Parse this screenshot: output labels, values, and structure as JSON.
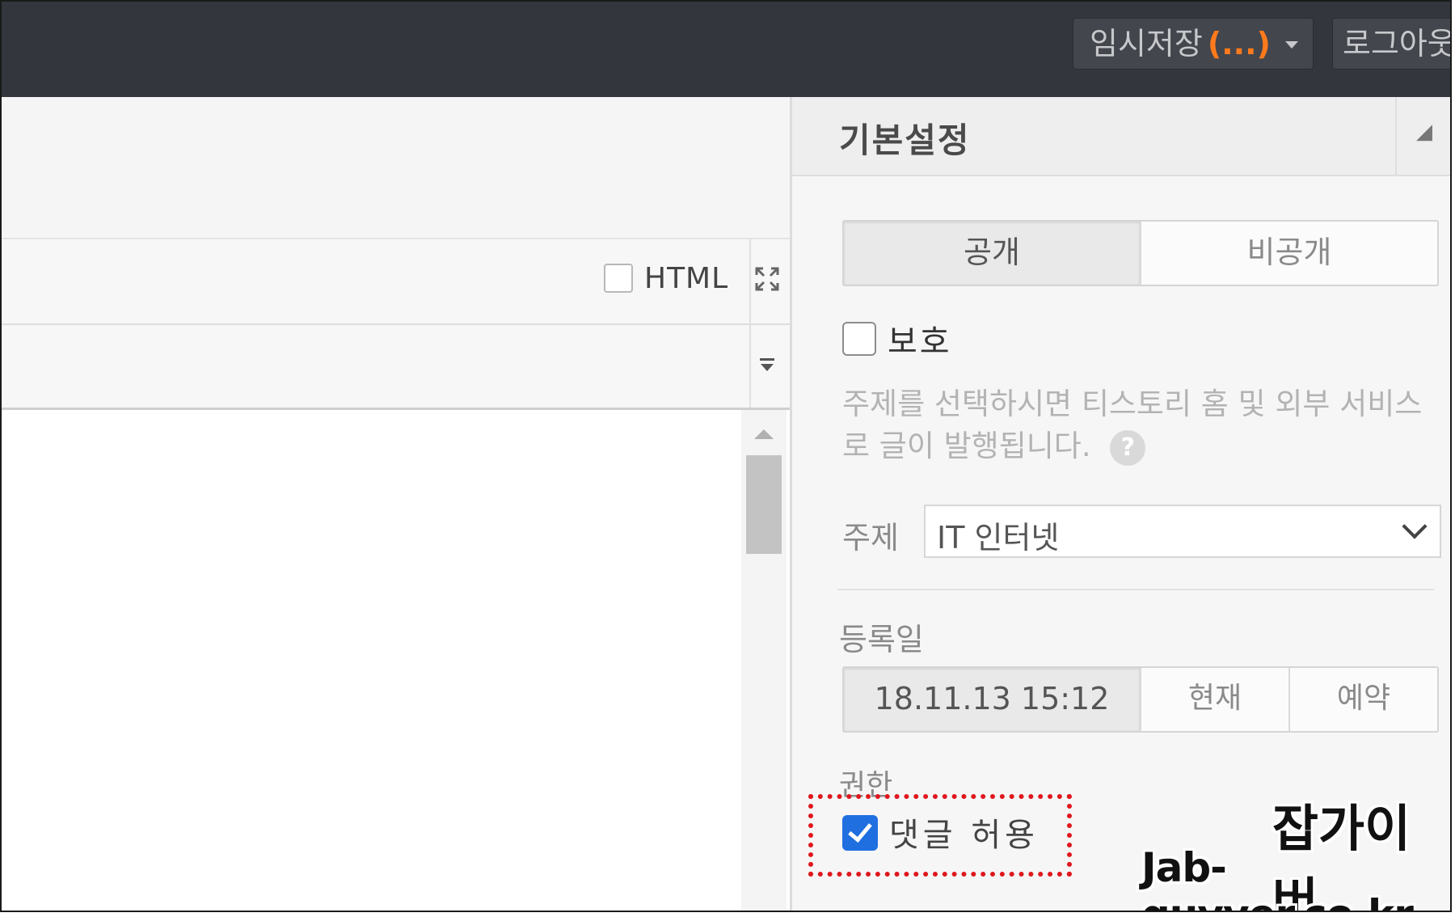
{
  "topbar": {
    "temp_save_label": "임시저장",
    "temp_save_count": "(...)",
    "logout_label": "로그아웃"
  },
  "editor": {
    "html_mode_label": "HTML"
  },
  "panel": {
    "title": "기본설정",
    "visibility": {
      "options": [
        "공개",
        "비공개"
      ],
      "selected": "공개"
    },
    "protect_label": "보호",
    "topic_note": "주제를 선택하시면 티스토리 홈 및 외부 서비스로 글이 발행됩니다.",
    "help_glyph": "?",
    "topic_label": "주제",
    "topic_value": "IT 인터넷",
    "date_label": "등록일",
    "date_value": "18.11.13 15:12",
    "date_now_label": "현재",
    "date_schedule_label": "예약",
    "permission_label": "권한",
    "comment_allow_label": "댓글 허용",
    "comment_allow_checked": true
  },
  "watermark": {
    "korean": "잡가이버",
    "url": "Jab-guyver.co.kr"
  },
  "colors": {
    "topbar": "#33363d",
    "accent_orange": "#ff7a1c",
    "checkbox_blue": "#1f6fe0",
    "highlight_red": "#e0161d"
  }
}
